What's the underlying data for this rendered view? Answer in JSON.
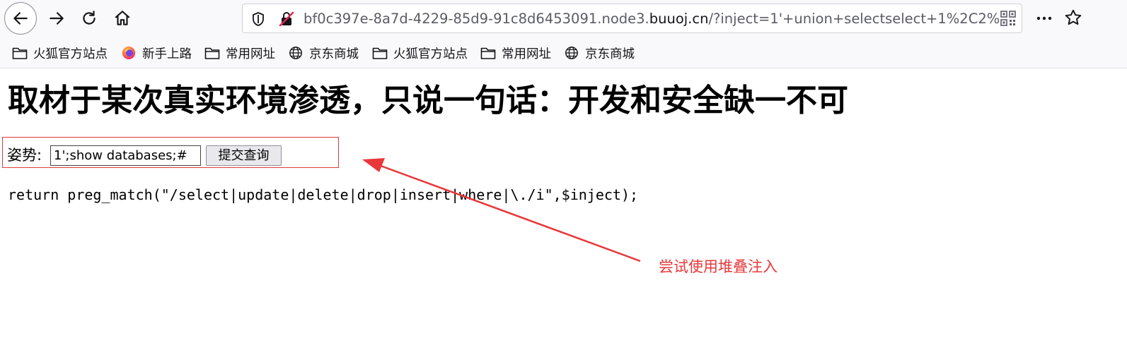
{
  "toolbar": {
    "url_prefix": "bf0c397e-8a7d-4229-85d9-91c8d6453091.node3.",
    "url_domain": "buuoj.cn",
    "url_suffix": "/?inject=1'+union+selectselect+1%2C2%2",
    "icons": [
      "back-arrow-icon",
      "forward-arrow-icon",
      "reload-icon",
      "home-icon",
      "shield-icon",
      "insecure-lock-icon",
      "qr-code-icon",
      "more-dots-icon",
      "star-icon"
    ]
  },
  "bookmarks": {
    "items": [
      {
        "label": "火狐官方站点",
        "icon": "folder-icon"
      },
      {
        "label": "新手上路",
        "icon": "firefox-icon"
      },
      {
        "label": "常用网址",
        "icon": "folder-icon"
      },
      {
        "label": "京东商城",
        "icon": "globe-icon"
      },
      {
        "label": "火狐官方站点",
        "icon": "folder-icon"
      },
      {
        "label": "常用网址",
        "icon": "folder-icon"
      },
      {
        "label": "京东商城",
        "icon": "globe-icon"
      }
    ]
  },
  "content": {
    "title": "取材于某次真实环境渗透，只说一句话：开发和安全缺一不可",
    "form_label": "姿势:",
    "input_value": "1';show databases;#",
    "submit_label": "提交查询",
    "code": "return preg_match(\"/select|update|delete|drop|insert|where|\\./i\",$inject);"
  },
  "annotation": {
    "text": "尝试使用堆叠注入",
    "color": "#e8383a"
  },
  "colors": {
    "toolbar_bg": "#f9f9fb",
    "highlight_box": "#e23a3a"
  }
}
